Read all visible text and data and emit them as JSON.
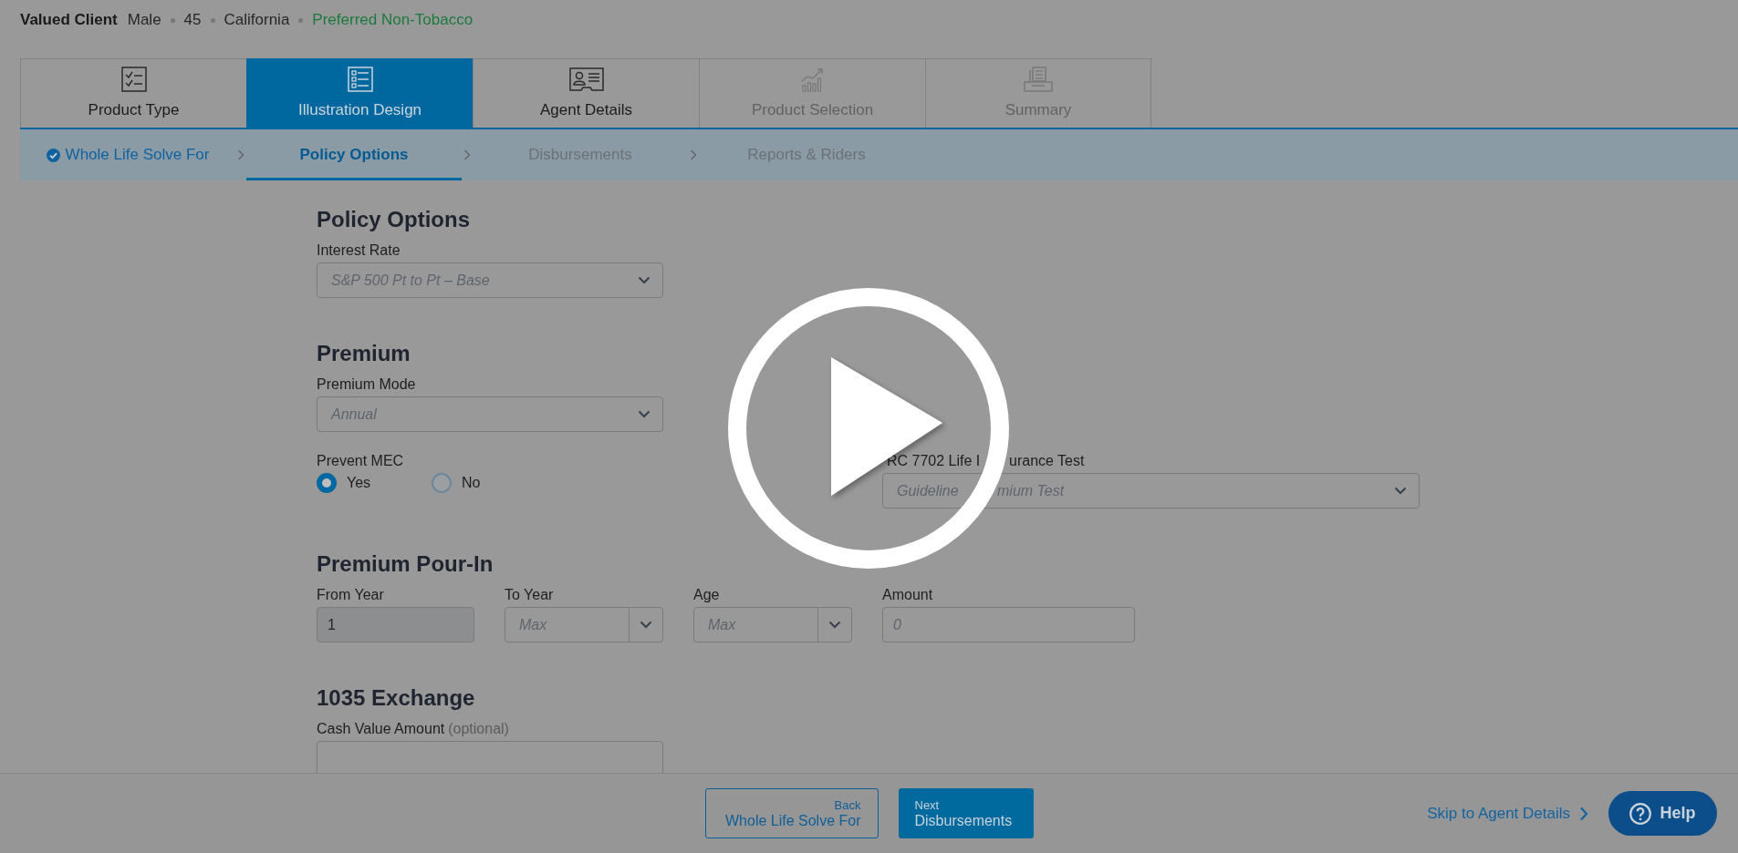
{
  "client": {
    "name": "Valued Client",
    "details": [
      {
        "text": "Male",
        "kind": "plain"
      },
      {
        "text": "45",
        "kind": "plain"
      },
      {
        "text": "California",
        "kind": "plain"
      },
      {
        "text": "Preferred Non-Tobacco",
        "kind": "rate_class"
      }
    ]
  },
  "tabs": [
    {
      "label": "Product Type",
      "selected": false,
      "disabled": false
    },
    {
      "label": "Illustration Design",
      "selected": true,
      "disabled": false
    },
    {
      "label": "Agent Details",
      "selected": false,
      "disabled": false
    },
    {
      "label": "Product Selection",
      "selected": false,
      "disabled": true
    },
    {
      "label": "Summary",
      "selected": false,
      "disabled": true
    }
  ],
  "steps": [
    {
      "label": "Whole Life Solve For",
      "selected": false,
      "completed": true
    },
    {
      "label": "Policy Options",
      "selected": true,
      "completed": false
    },
    {
      "label": "Disbursements",
      "selected": false,
      "completed": false
    },
    {
      "label": "Reports & Riders",
      "selected": false,
      "completed": false
    }
  ],
  "sections": [
    {
      "title": "Policy Options",
      "rows": [
        [
          {
            "kind": "select",
            "label": "Interest Rate",
            "placeholder": "S&P 500 Pt to Pt – Base"
          }
        ]
      ]
    },
    {
      "title": "Premium",
      "rows": [
        [
          {
            "kind": "select",
            "label": "Premium Mode",
            "placeholder": "Annual"
          }
        ],
        [
          {
            "kind": "radio",
            "label": "Prevent MEC",
            "options": [
              {
                "label": "Yes",
                "selected": true
              },
              {
                "label": "No",
                "selected": false
              }
            ]
          },
          {
            "kind": "select",
            "label_fragments": [
              "RC 7702 Life I",
              "urance Test"
            ],
            "placeholder_fragments": [
              "Guideline",
              "mium Test"
            ]
          }
        ]
      ]
    },
    {
      "title": "Premium Pour-In",
      "rows": [
        [
          {
            "kind": "input",
            "label": "From Year",
            "value": "1",
            "disabled": true
          },
          {
            "kind": "combo",
            "label": "To Year",
            "placeholder": "Max"
          },
          {
            "kind": "combo",
            "label": "Age",
            "placeholder": "Max"
          },
          {
            "kind": "input",
            "label": "Amount",
            "placeholder": "0",
            "disabled": false
          }
        ]
      ]
    },
    {
      "title": "1035 Exchange",
      "rows": [
        [
          {
            "kind": "input",
            "label": "Cash Value Amount",
            "note": "(optional)",
            "disabled": false
          }
        ]
      ]
    }
  ],
  "footer": {
    "back": {
      "caption": "Back",
      "label": "Whole Life Solve For"
    },
    "next": {
      "caption": "Next",
      "label": "Disbursements"
    },
    "skip_link": "Skip to Agent Details",
    "help": "Help"
  },
  "player": {
    "paused": true
  }
}
